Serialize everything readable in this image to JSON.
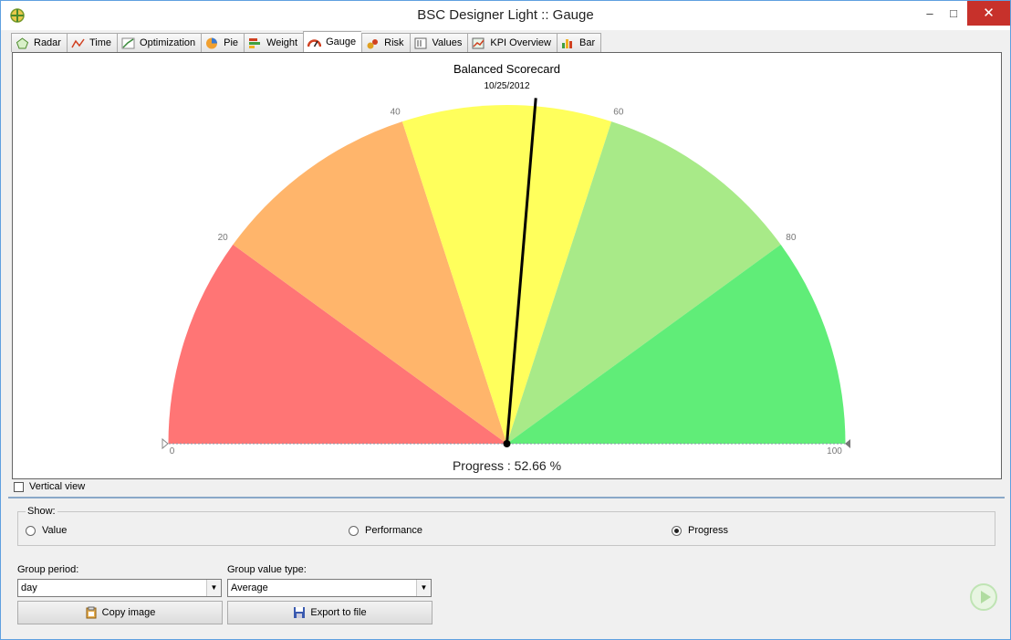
{
  "window": {
    "title": "BSC Designer Light :: Gauge"
  },
  "tabs": [
    {
      "label": "Radar",
      "icon": "radar-icon"
    },
    {
      "label": "Time",
      "icon": "time-chart-icon"
    },
    {
      "label": "Optimization",
      "icon": "optimization-icon"
    },
    {
      "label": "Pie",
      "icon": "pie-icon"
    },
    {
      "label": "Weight",
      "icon": "weight-icon"
    },
    {
      "label": "Gauge",
      "icon": "gauge-icon"
    },
    {
      "label": "Risk",
      "icon": "risk-icon"
    },
    {
      "label": "Values",
      "icon": "values-icon"
    },
    {
      "label": "KPI Overview",
      "icon": "kpi-overview-icon"
    },
    {
      "label": "Bar",
      "icon": "bar-icon"
    }
  ],
  "active_tab": "Gauge",
  "chart_data": {
    "type": "gauge",
    "title": "Balanced Scorecard",
    "subtitle": "10/25/2012",
    "range": [
      0,
      100
    ],
    "ticks": [
      {
        "value": 0,
        "label": "0"
      },
      {
        "value": 20,
        "label": "20"
      },
      {
        "value": 40,
        "label": "40"
      },
      {
        "value": 60,
        "label": "60"
      },
      {
        "value": 80,
        "label": "80"
      },
      {
        "value": 100,
        "label": "100"
      }
    ],
    "bands": [
      {
        "from": 0,
        "to": 20,
        "color": "#ff7575"
      },
      {
        "from": 20,
        "to": 40,
        "color": "#ffb56b"
      },
      {
        "from": 40,
        "to": 60,
        "color": "#ffff5c"
      },
      {
        "from": 60,
        "to": 80,
        "color": "#a8ea88"
      },
      {
        "from": 80,
        "to": 100,
        "color": "#60ed78"
      }
    ],
    "needle_value": 52.66,
    "value_label": "Progress : 52.66 %"
  },
  "vertical_view": {
    "label": "Vertical view",
    "checked": false
  },
  "show": {
    "label": "Show:",
    "options": [
      {
        "label": "Value",
        "checked": false
      },
      {
        "label": "Performance",
        "checked": false
      },
      {
        "label": "Progress",
        "checked": true
      }
    ]
  },
  "group_period": {
    "label": "Group period:",
    "value": "day"
  },
  "group_value_type": {
    "label": "Group value type:",
    "value": "Average"
  },
  "buttons": {
    "copy_image": "Copy image",
    "export_to_file": "Export to file"
  }
}
